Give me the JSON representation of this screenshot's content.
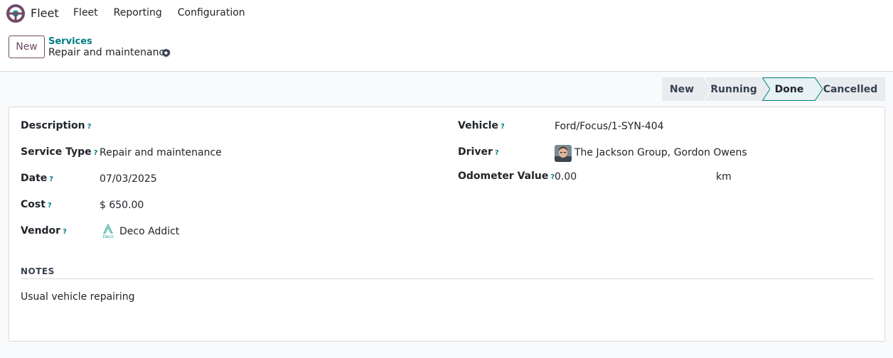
{
  "navbar": {
    "app_name": "Fleet",
    "menu": [
      "Fleet",
      "Reporting",
      "Configuration"
    ]
  },
  "control_panel": {
    "new_label": "New",
    "breadcrumb": "Services",
    "record_title": "Repair and maintenance"
  },
  "statusbar": {
    "stages": [
      "New",
      "Running",
      "Done",
      "Cancelled"
    ],
    "current": "Done"
  },
  "form": {
    "description": {
      "label": "Description",
      "help": "?",
      "value": ""
    },
    "service_type": {
      "label": "Service Type",
      "help": "?",
      "value": "Repair and maintenance"
    },
    "date": {
      "label": "Date",
      "help": "?",
      "value": "07/03/2025"
    },
    "cost": {
      "label": "Cost",
      "help": "?",
      "value": "$ 650.00"
    },
    "vendor": {
      "label": "Vendor",
      "help": "?",
      "value": "Deco Addict",
      "logo_text": "Deco"
    },
    "vehicle": {
      "label": "Vehicle",
      "help": "?",
      "value": "Ford/Focus/1-SYN-404"
    },
    "driver": {
      "label": "Driver",
      "help": "?",
      "value": "The Jackson Group, Gordon Owens"
    },
    "odometer": {
      "label": "Odometer Value",
      "help": "?",
      "value": "0.00",
      "unit": "km"
    }
  },
  "notes": {
    "heading": "NOTES",
    "text": "Usual vehicle repairing"
  },
  "colors": {
    "brand": "#714b67",
    "link": "#017e84",
    "stage_active": "#e6f2f3"
  }
}
